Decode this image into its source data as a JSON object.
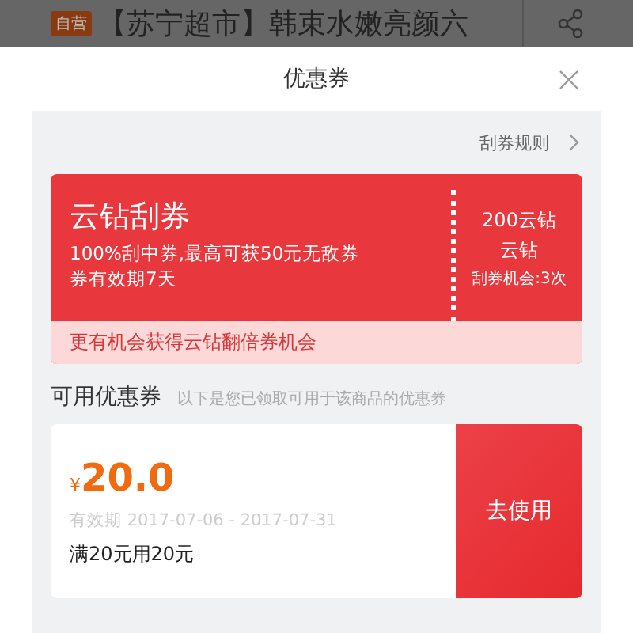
{
  "product_bar": {
    "badge": "自营",
    "title": "【苏宁超市】韩束水嫩亮颜六"
  },
  "sheet": {
    "title": "优惠券"
  },
  "rules_link": "刮券规则",
  "scratch_card": {
    "title": "云钻刮券",
    "line_1": "100%刮中券,最高可获50元无敌券",
    "line_2": "券有效期7天",
    "cost": "200云钻",
    "unit": "云钻",
    "chances": "刮券机会:3次",
    "footer": "更有机会获得云钻翻倍券机会"
  },
  "available": {
    "heading": "可用优惠券",
    "hint": "以下是您已领取可用于该商品的优惠券"
  },
  "coupons": [
    {
      "currency": "¥",
      "amount": "20.0",
      "validity": "有效期 2017-07-06 - 2017-07-31",
      "condition": "满20元用20元",
      "action": "去使用"
    }
  ]
}
